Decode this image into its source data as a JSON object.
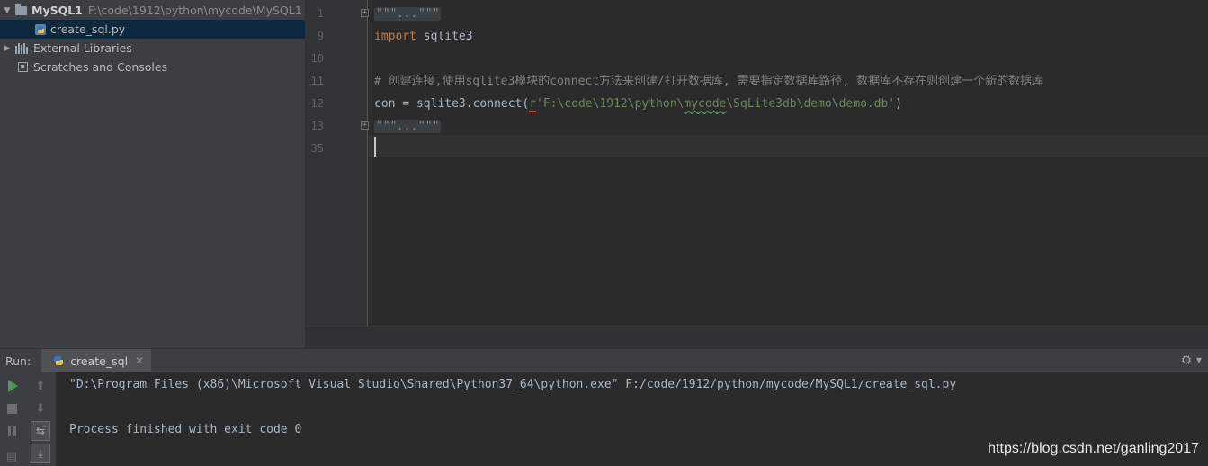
{
  "project_tree": {
    "root": {
      "name": "MySQL1",
      "path": "F:\\code\\1912\\python\\mycode\\MySQL1"
    },
    "items": [
      {
        "label": "create_sql.py",
        "icon": "python-file-icon",
        "selected": true
      },
      {
        "label": "External Libraries",
        "icon": "libraries-icon"
      },
      {
        "label": "Scratches and Consoles",
        "icon": "scratches-icon"
      }
    ]
  },
  "editor": {
    "lines": [
      {
        "number": "1",
        "folded": "\"\"\"...\"\"\""
      },
      {
        "number": "9",
        "keyword": "import",
        "text": " sqlite3"
      },
      {
        "number": "10"
      },
      {
        "number": "11",
        "comment": "# 创建连接,使用sqlite3模块的connect方法来创建/打开数据库, 需要指定数据库路径, 数据库不存在则创建一个新的数据库"
      },
      {
        "number": "12",
        "code_before": "con = sqlite3.connect(",
        "prefix": "r",
        "str_open": "'F:\\code\\1912\\python\\",
        "str_typo": "mycode",
        "str_rest": "\\SqLite3db\\demo\\demo.db'",
        "code_after": ")"
      },
      {
        "number": "13",
        "folded": "\"\"\"...\"\"\""
      },
      {
        "number": "35"
      }
    ]
  },
  "run_panel": {
    "label": "Run:",
    "tab": "create_sql",
    "output": [
      "\"D:\\Program Files (x86)\\Microsoft Visual Studio\\Shared\\Python37_64\\python.exe\" F:/code/1912/python/mycode/MySQL1/create_sql.py",
      "Process finished with exit code 0"
    ]
  },
  "watermark": "https://blog.csdn.net/ganling2017",
  "colors": {
    "keyword": "#cc7832",
    "comment": "#808080",
    "string": "#6a8759",
    "run_green": "#499c54",
    "selection": "#0d293e"
  }
}
